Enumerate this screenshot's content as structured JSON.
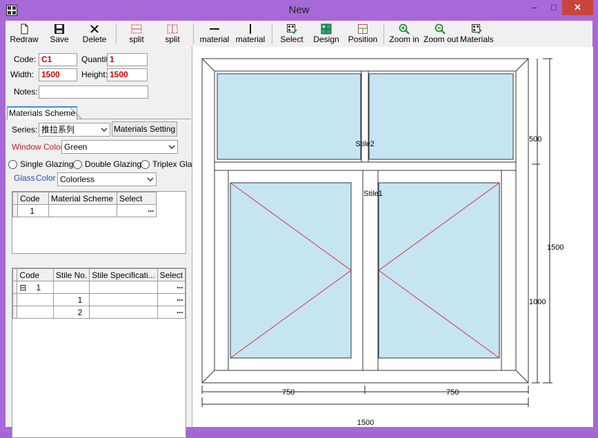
{
  "window": {
    "title": "New",
    "minimize_glyph": "–",
    "maximize_glyph": "□",
    "close_glyph": "✕"
  },
  "toolbar": {
    "buttons": [
      {
        "label": "Redraw",
        "icon": "page-icon"
      },
      {
        "label": "Save",
        "icon": "floppy-disk-icon"
      },
      {
        "label": "Delete",
        "icon": "x-icon"
      },
      {
        "label": "split",
        "icon": "horizontal-split-icon"
      },
      {
        "label": "split",
        "icon": "vertical-split-icon"
      },
      {
        "label": "material",
        "icon": "horizontal-bar-icon"
      },
      {
        "label": "material",
        "icon": "vertical-bar-icon"
      },
      {
        "label": "Select",
        "icon": "select-grid-icon"
      },
      {
        "label": "Design",
        "icon": "design-grid-icon"
      },
      {
        "label": "Position",
        "icon": "position-icon"
      },
      {
        "label": "Zoom in",
        "icon": "zoom-in-icon"
      },
      {
        "label": "Zoom out",
        "icon": "zoom-out-icon"
      },
      {
        "label": "Materials",
        "icon": "materials-icon"
      }
    ]
  },
  "form": {
    "code_label": "Code:",
    "code_value": "C1",
    "quantity_label": "Quantity",
    "quantity_value": "1",
    "width_label": "Width:",
    "width_value": "1500",
    "height_label": "Height:",
    "height_value": "1500",
    "notes_label": "Notes:",
    "notes_value": ""
  },
  "tab": {
    "label": "Materials Scheme"
  },
  "scheme": {
    "series_label": "Series:",
    "series_value": "推拉系列",
    "materials_setting_button": "Materials Setting",
    "window_color_label": "Window Color",
    "window_color_value": "Green",
    "glazing_options": [
      "Single Glazing",
      "Double Glazing",
      "Triplex Glas"
    ],
    "glass_label": "Glass",
    "color_label": "Color",
    "glass_color_value": "Colorless"
  },
  "grid1": {
    "headers": [
      "Code",
      "Material Scheme",
      "Select"
    ],
    "rows": [
      {
        "code": "1",
        "scheme": "",
        "select": "···"
      }
    ]
  },
  "grid2": {
    "headers": [
      "Code",
      "Stile No.",
      "Stile Specificati...",
      "Select"
    ],
    "rows": [
      {
        "tree": "⊟",
        "code": "1",
        "stile_no": "",
        "spec": "",
        "select": "···"
      },
      {
        "tree": "",
        "code": "",
        "stile_no": "1",
        "spec": "",
        "select": "···"
      },
      {
        "tree": "",
        "code": "",
        "stile_no": "2",
        "spec": "",
        "select": "···"
      }
    ]
  },
  "drawing": {
    "stile_labels": [
      "Stile2",
      "Stile1"
    ],
    "dim_top_height": "500",
    "dim_bottom_height": "1000",
    "dim_total_height": "1500",
    "dim_left_width": "750",
    "dim_right_width": "750",
    "dim_total_width": "1500",
    "glass_color": "#c5e5f3",
    "frame_color": "#ffffff",
    "opening_line_color": "#e0303a"
  }
}
